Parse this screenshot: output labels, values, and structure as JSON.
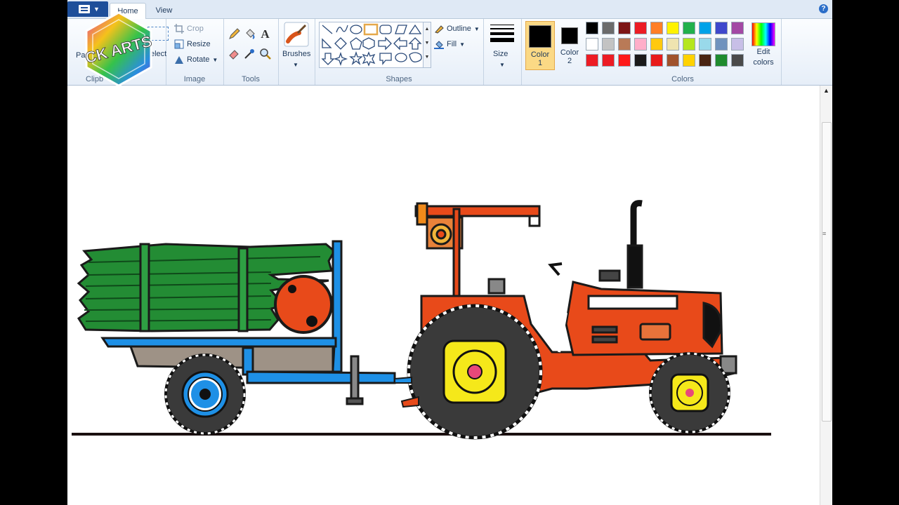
{
  "window": {
    "tabs": [
      {
        "label": "Home"
      },
      {
        "label": "View"
      }
    ],
    "help_label": "?"
  },
  "watermark": {
    "text": "CK ARTS"
  },
  "ribbon": {
    "clipboard": {
      "paste_label": "Pa",
      "select_label": "elect",
      "group_label": "Clipb"
    },
    "image": {
      "crop_label": "Crop",
      "resize_label": "Resize",
      "rotate_label": "Rotate",
      "group_label": "Image"
    },
    "tools": {
      "group_label": "Tools",
      "text_tool_glyph": "A"
    },
    "brushes": {
      "label": "Brushes"
    },
    "shapes": {
      "outline_label": "Outline",
      "fill_label": "Fill",
      "group_label": "Shapes"
    },
    "size": {
      "label": "Size"
    },
    "color1": {
      "label_line1": "Color",
      "label_line2": "1",
      "value": "#000000"
    },
    "color2": {
      "label_line1": "Color",
      "label_line2": "2",
      "value": "#000000"
    },
    "colors": {
      "group_label": "Colors",
      "edit_label_line1": "Edit",
      "edit_label_line2": "colors",
      "palette_row1": [
        "#000000",
        "#6b6b6b",
        "#7d1616",
        "#ec1c24",
        "#ff7f27",
        "#fff200",
        "#22b14c",
        "#00a2e8",
        "#3f48cc",
        "#a349a4"
      ],
      "palette_row2": [
        "#ffffff",
        "#c3c3c3",
        "#b97a57",
        "#ffaec9",
        "#ffc90e",
        "#efe4b0",
        "#b5e61d",
        "#99d9ea",
        "#7092be",
        "#c8bfe7"
      ],
      "palette_row3": [
        "#ed1c24",
        "#ec1c24",
        "#ff1a1a",
        "#1a1a1a",
        "#e81b1b",
        "#a0522d",
        "#ffd200",
        "#4a2412",
        "#1f8b2e",
        "#4a4a4a"
      ]
    }
  }
}
